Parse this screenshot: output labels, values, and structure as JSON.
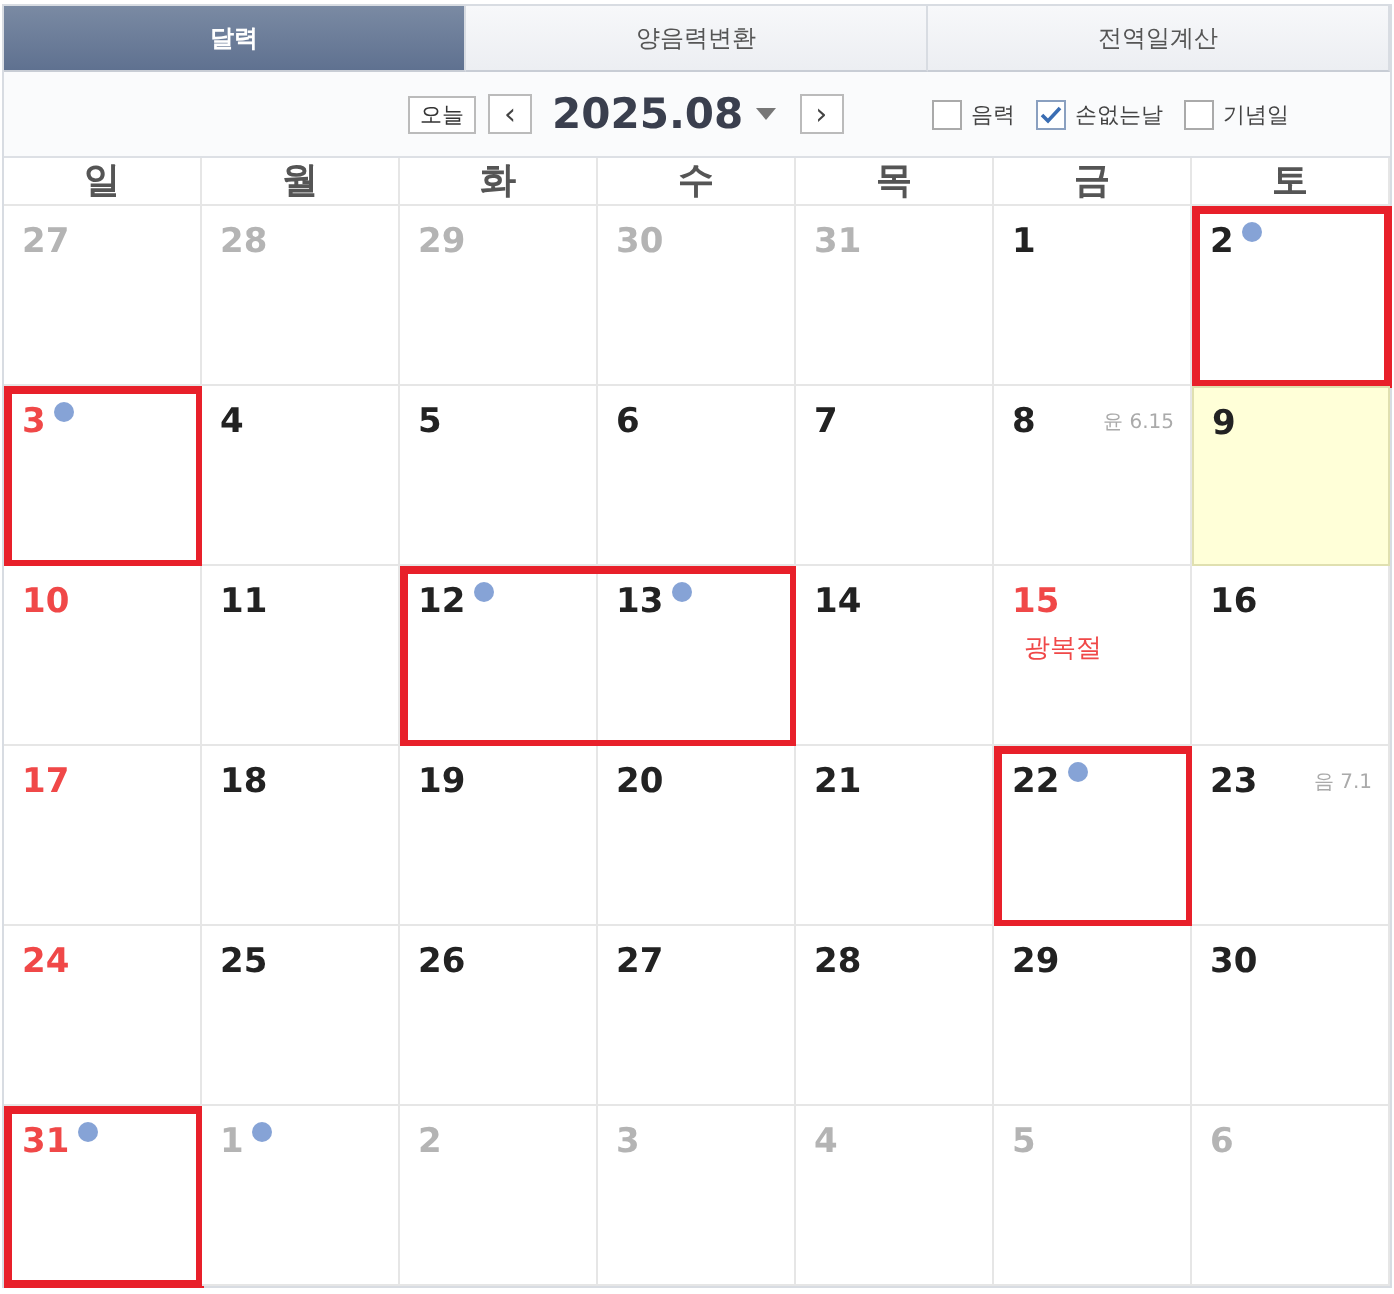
{
  "tabs": [
    {
      "label": "달력",
      "selected": true
    },
    {
      "label": "양음력변환",
      "selected": false
    },
    {
      "label": "전역일계산",
      "selected": false
    }
  ],
  "toolbar": {
    "today_button": "오늘",
    "prev_button": "‹",
    "month": "2025.08",
    "next_button": "›",
    "options": [
      {
        "label": "음력",
        "checked": false
      },
      {
        "label": "손없는날",
        "checked": true
      },
      {
        "label": "기념일",
        "checked": false
      }
    ]
  },
  "weekdays": [
    "일",
    "월",
    "화",
    "수",
    "목",
    "금",
    "토"
  ],
  "days": [
    {
      "number": "27",
      "muted": true
    },
    {
      "number": "28",
      "muted": true
    },
    {
      "number": "29",
      "muted": true
    },
    {
      "number": "30",
      "muted": true
    },
    {
      "number": "31",
      "muted": true
    },
    {
      "number": "1"
    },
    {
      "number": "2",
      "dot": true,
      "marked": true
    },
    {
      "number": "3",
      "red": true,
      "dot": true,
      "marked": true
    },
    {
      "number": "4"
    },
    {
      "number": "5"
    },
    {
      "number": "6"
    },
    {
      "number": "7"
    },
    {
      "number": "8",
      "note": {
        "kind": "lunar",
        "text": "윤 6.15"
      }
    },
    {
      "number": "9",
      "today": true
    },
    {
      "number": "10",
      "red": true
    },
    {
      "number": "11"
    },
    {
      "number": "12",
      "dot": true,
      "marked": true
    },
    {
      "number": "13",
      "dot": true,
      "marked": true
    },
    {
      "number": "14"
    },
    {
      "number": "15",
      "red": true,
      "note": {
        "kind": "holiday",
        "text": "광복절"
      }
    },
    {
      "number": "16"
    },
    {
      "number": "17",
      "red": true
    },
    {
      "number": "18"
    },
    {
      "number": "19"
    },
    {
      "number": "20"
    },
    {
      "number": "21"
    },
    {
      "number": "22",
      "dot": true,
      "marked": true
    },
    {
      "number": "23",
      "note": {
        "kind": "lunar",
        "text": "음 7.1"
      }
    },
    {
      "number": "24",
      "red": true
    },
    {
      "number": "25"
    },
    {
      "number": "26"
    },
    {
      "number": "27"
    },
    {
      "number": "28"
    },
    {
      "number": "29"
    },
    {
      "number": "30"
    },
    {
      "number": "31",
      "red": true,
      "dot": true,
      "marked": true
    },
    {
      "number": "1",
      "muted": true,
      "dot": true
    },
    {
      "number": "2",
      "muted": true
    },
    {
      "number": "3",
      "muted": true
    },
    {
      "number": "4",
      "muted": true
    },
    {
      "number": "5",
      "muted": true
    },
    {
      "number": "6",
      "muted": true
    }
  ]
}
